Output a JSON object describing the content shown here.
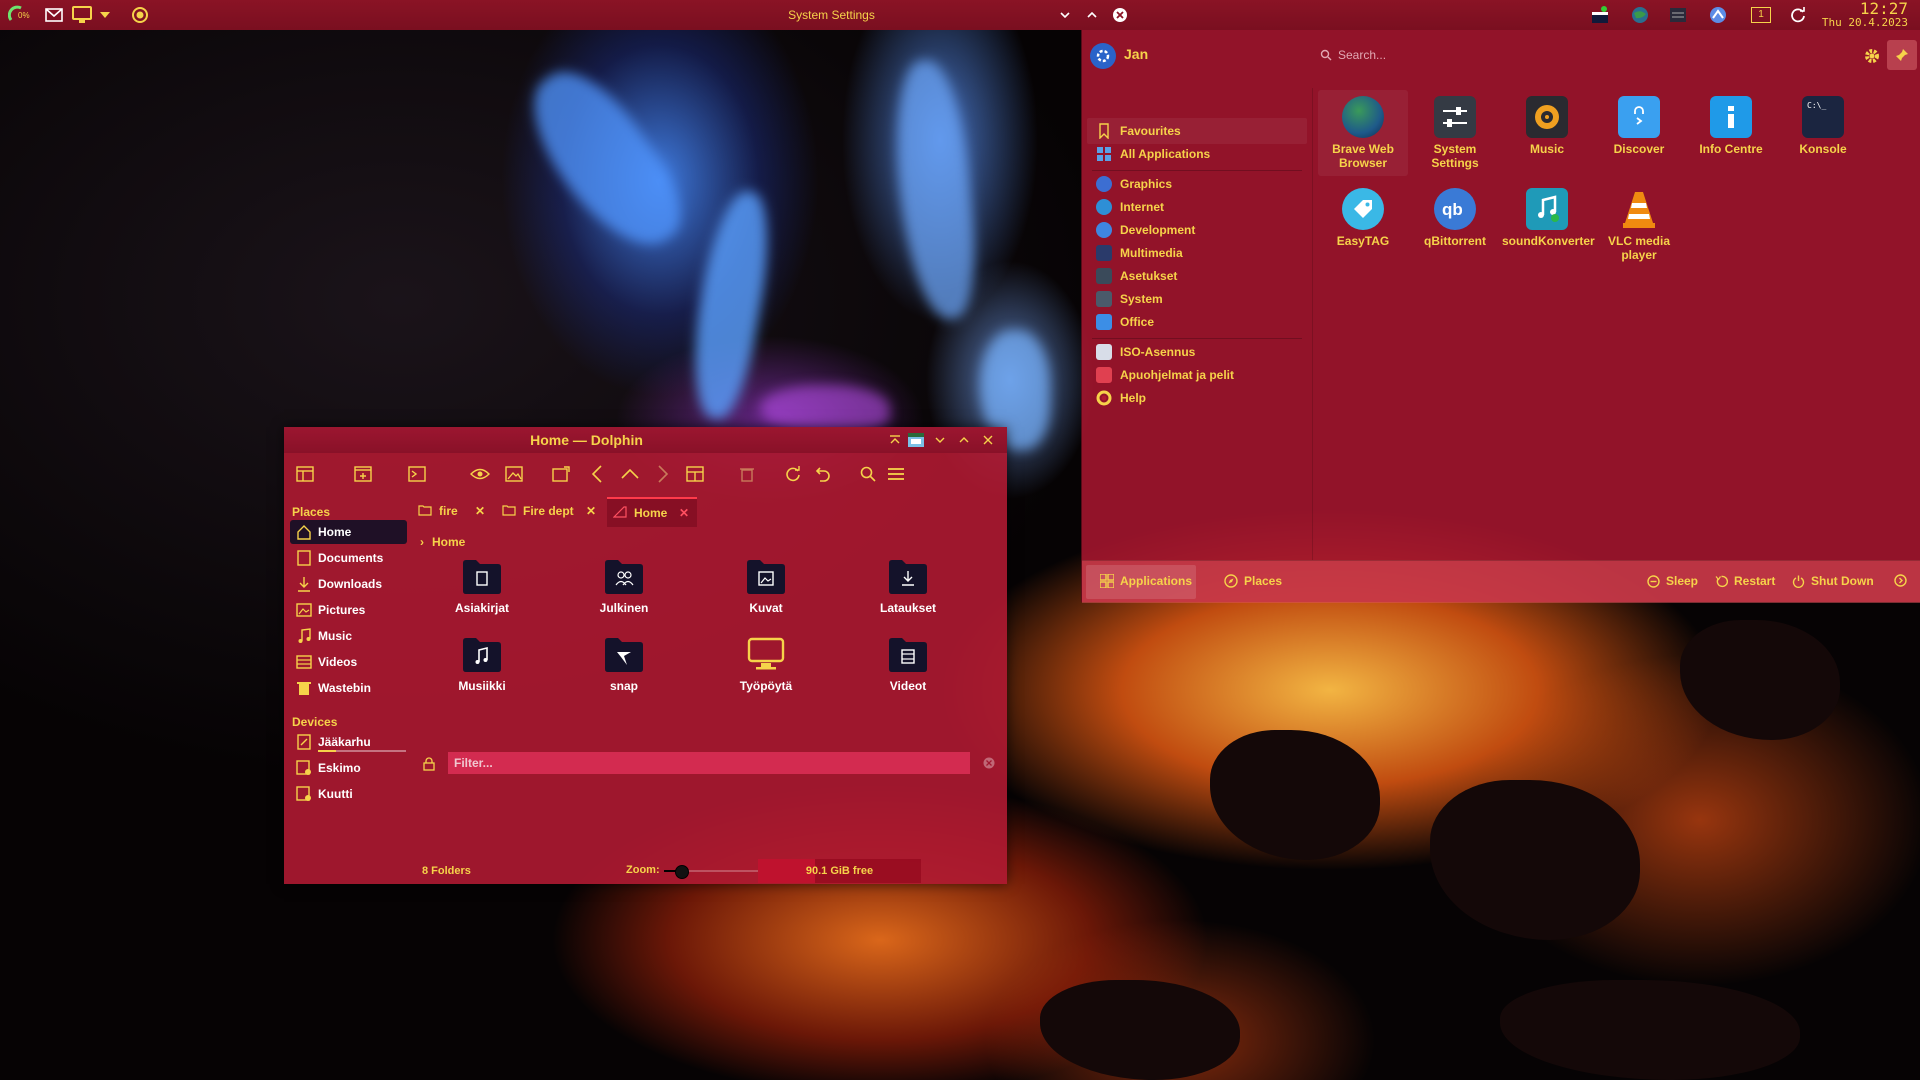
{
  "top_panel": {
    "battery_label": "0%",
    "center_title": "System Settings",
    "tray_digit": "1",
    "clock_time": "12:27",
    "clock_date": "Thu 20.4.2023"
  },
  "launcher": {
    "user_name": "Jan",
    "search_placeholder": "Search...",
    "categories": [
      {
        "label": "Favourites",
        "icon": "bookmark-icon"
      },
      {
        "label": "All Applications",
        "icon": "grid-icon"
      },
      {
        "label": "Graphics",
        "icon": "graphics-icon"
      },
      {
        "label": "Internet",
        "icon": "globe-icon"
      },
      {
        "label": "Development",
        "icon": "development-icon"
      },
      {
        "label": "Multimedia",
        "icon": "multimedia-icon"
      },
      {
        "label": "Asetukset",
        "icon": "settings-icon"
      },
      {
        "label": "System",
        "icon": "system-icon"
      },
      {
        "label": "Office",
        "icon": "office-icon"
      },
      {
        "label": "ISO-Asennus",
        "icon": "iso-icon"
      },
      {
        "label": "Apuohjelmat ja pelit",
        "icon": "games-icon"
      },
      {
        "label": "Help",
        "icon": "help-icon"
      }
    ],
    "apps": [
      {
        "label": "Brave Web Browser",
        "icon": "globe-icon"
      },
      {
        "label": "System Settings",
        "icon": "sliders-icon"
      },
      {
        "label": "Music",
        "icon": "speaker-icon"
      },
      {
        "label": "Discover",
        "icon": "shopping-bag-icon"
      },
      {
        "label": "Info Centre",
        "icon": "info-icon"
      },
      {
        "label": "Konsole",
        "icon": "terminal-icon"
      },
      {
        "label": "EasyTAG",
        "icon": "tag-icon"
      },
      {
        "label": "qBittorrent",
        "icon": "qbittorrent-icon"
      },
      {
        "label": "soundKonverter",
        "icon": "music-note-icon"
      },
      {
        "label": "VLC media player",
        "icon": "vlc-cone-icon"
      }
    ],
    "footer": {
      "applications": "Applications",
      "places": "Places",
      "sleep": "Sleep",
      "restart": "Restart",
      "shutdown": "Shut Down"
    }
  },
  "dolphin": {
    "title": "Home — Dolphin",
    "places_heading": "Places",
    "places": [
      {
        "label": "Home",
        "icon": "home-icon"
      },
      {
        "label": "Documents",
        "icon": "documents-icon"
      },
      {
        "label": "Downloads",
        "icon": "download-icon"
      },
      {
        "label": "Pictures",
        "icon": "pictures-icon"
      },
      {
        "label": "Music",
        "icon": "music-icon"
      },
      {
        "label": "Videos",
        "icon": "videos-icon"
      },
      {
        "label": "Wastebin",
        "icon": "trash-icon"
      }
    ],
    "devices_heading": "Devices",
    "devices": [
      {
        "label": "Jääkarhu",
        "icon": "drive-icon",
        "used_fraction": 0.2
      },
      {
        "label": "Eskimo",
        "icon": "drive-icon"
      },
      {
        "label": "Kuutti",
        "icon": "drive-icon"
      }
    ],
    "tabs": [
      {
        "label": "fire"
      },
      {
        "label": "Fire dept"
      },
      {
        "label": "Home"
      }
    ],
    "breadcrumb": "Home",
    "folders": [
      {
        "label": "Asiakirjat",
        "icon": "document-folder-icon"
      },
      {
        "label": "Julkinen",
        "icon": "public-folder-icon"
      },
      {
        "label": "Kuvat",
        "icon": "pictures-folder-icon"
      },
      {
        "label": "Lataukset",
        "icon": "download-folder-icon"
      },
      {
        "label": "Musiikki",
        "icon": "music-folder-icon"
      },
      {
        "label": "snap",
        "icon": "snap-folder-icon"
      },
      {
        "label": "Työpöytä",
        "icon": "desktop-folder-icon"
      },
      {
        "label": "Videot",
        "icon": "video-folder-icon"
      }
    ],
    "filter_placeholder": "Filter...",
    "status_count": "8 Folders",
    "zoom_label": "Zoom:",
    "zoom_fraction": 0.18,
    "free_space_label": "90.1 GiB free",
    "free_space_used_fraction": 0.35
  },
  "colors": {
    "panel_bg": "#8a1325",
    "accent_text": "#f6d34a",
    "launcher_bg": "#aa1630",
    "dolphin_bg": "#af1932",
    "folder_icon": "#14122a"
  }
}
